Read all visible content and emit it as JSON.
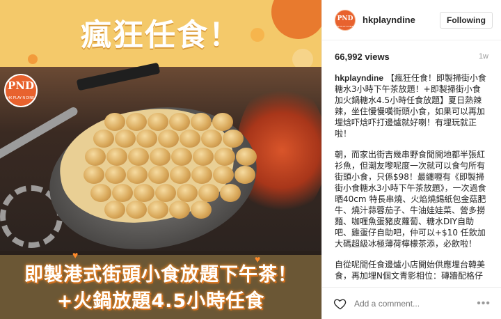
{
  "media": {
    "headline": "瘋狂任食！",
    "bottom_line_1": "即製港式街頭小食放題下午茶！",
    "bottom_line_2": "+火鍋放題4.5小時任食",
    "logo_text": "PND",
    "logo_subtext": "HK PLAY N DINE"
  },
  "post": {
    "account": {
      "username": "hkplayndine",
      "avatar_text": "PND",
      "avatar_subtext": "HK PLAY N DINE"
    },
    "follow_label": "Following",
    "views": "66,992 views",
    "age": "1w",
    "caption": {
      "username": "hkplayndine",
      "paragraph_1": "【瘋狂任食！即製掃街小食糖水3小時下午茶放題！+即製掃街小食加火鍋糖水4.5小時任食放題】夏日熱辣辣，坐住慢慢嘆街頭小食，如果可以再加埋焓吓焓吓打邊爐就好喇！有埋玩就正啦！",
      "paragraph_2": "朝，而家出街吉幾串野食閒開地都半張紅衫魚，但潮友嚟呢度一次就可以食勻所有街頭小食，只係$98！最纏喱有《即製掃街小食糖水3小時下午茶放題》，一次過食晒40cm 特長串燒、火焰燒錫紙包金菇肥牛、燒汁蒜蓉茄子、牛油娃娃菜、營多撈麵、咖喱魚蛋豬皮蘿蔔、糖水DIY自助吧、雞蛋仔自助吧，仲可以+$10 任飲加大碼超級冰極薄荷檸檬茶添，必飲啦！",
      "paragraph_3": "自從呢間任食邊爐小店開始供應埋台韓美食，再加埋N個文青影相位：磚牆配格仔飛行棋枱布、五子棋、鬥獸棋、飛行棋、公雞乜乜乜任玩任影，仲有超高難度嘅「電流急急棒」！靠個親仔樣未夠，內涵最重要。"
    },
    "comment_placeholder": "Add a comment...",
    "more_label": "•••"
  },
  "colors": {
    "brand": "#e8622e",
    "panel_bg": "#f4c96a"
  },
  "icons": [
    "heart-icon",
    "more-options-icon"
  ]
}
